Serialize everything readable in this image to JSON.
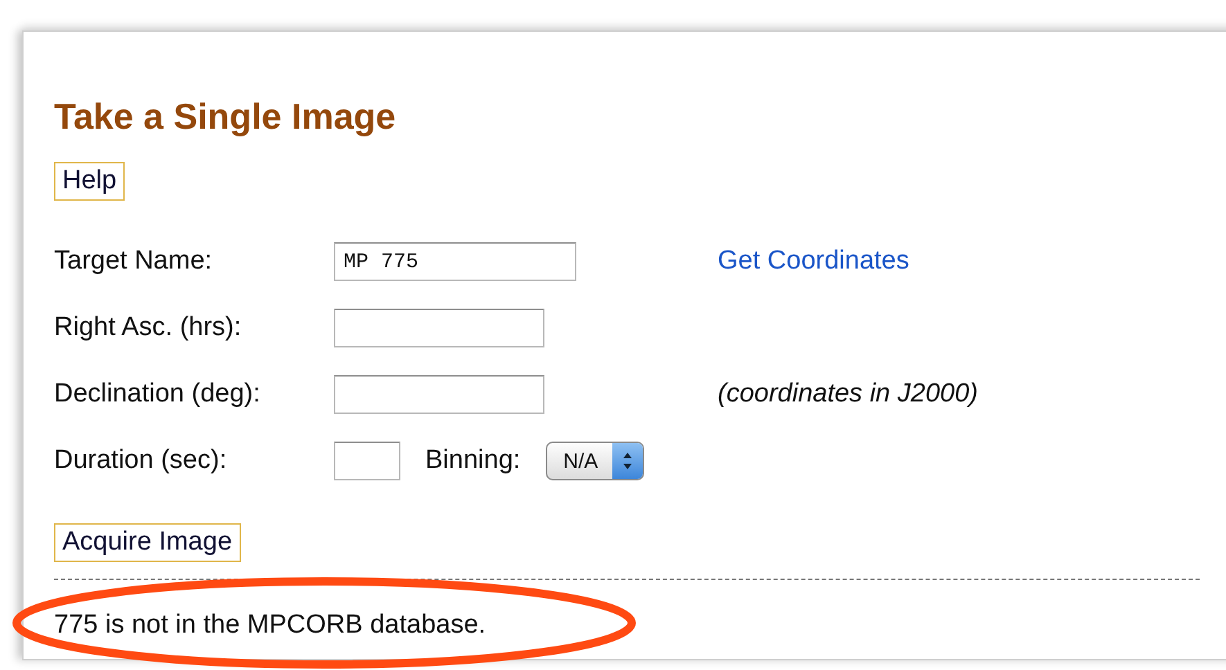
{
  "title": "Take a Single Image",
  "help_button": "Help",
  "rows": [
    {
      "label": "Target Name:",
      "value": "MP 775",
      "link": "Get Coordinates"
    },
    {
      "label": "Right Asc. (hrs):"
    },
    {
      "label": "Declination (deg):",
      "note": "(coordinates in J2000)"
    },
    {
      "label": "Duration (sec):",
      "binning": {
        "label": "Binning:",
        "value": "N/A"
      }
    }
  ],
  "acquire_button": "Acquire Image",
  "message": "775 is not in the MPCORB database.",
  "message_circled": true
}
